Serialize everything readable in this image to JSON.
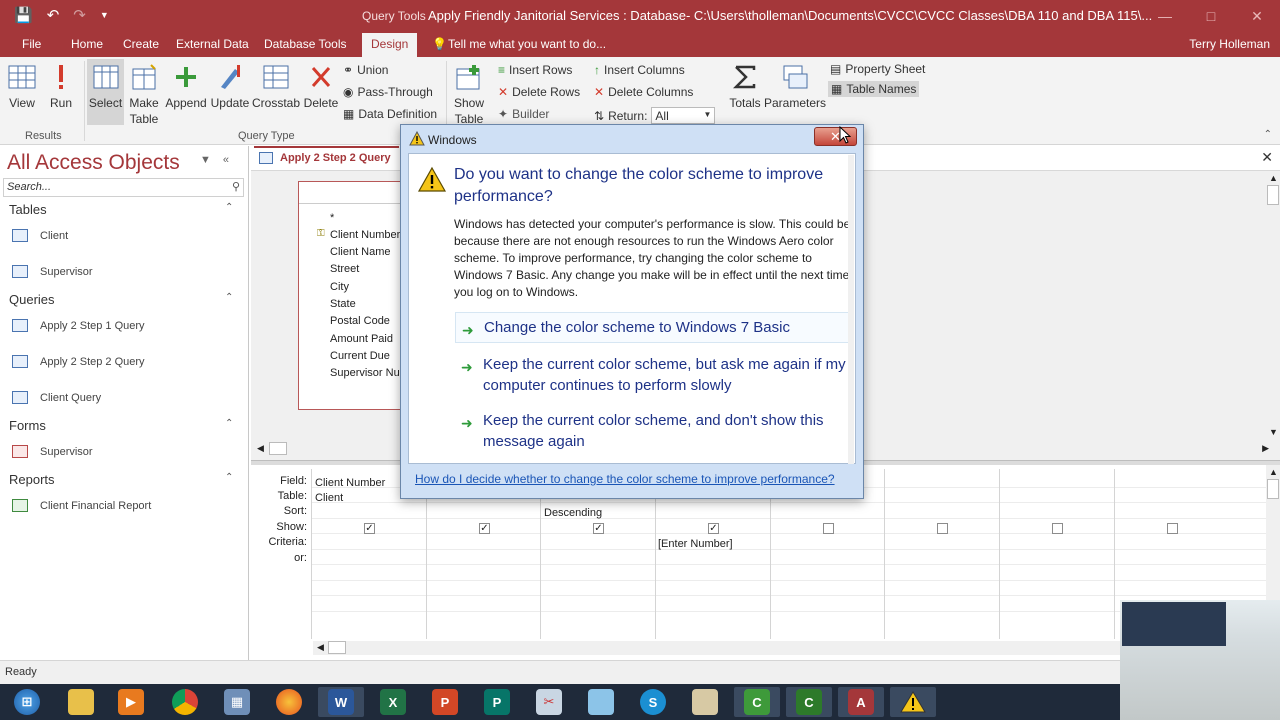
{
  "titlebar": {
    "context_tab": "Query Tools",
    "title": "Apply Friendly Janitorial Services : Database- C:\\Users\\tholleman\\Documents\\CVCC\\CVCC Classes\\DBA 110 and DBA 115\\..."
  },
  "tabs": {
    "file": "File",
    "home": "Home",
    "create": "Create",
    "external_data": "External Data",
    "database_tools": "Database Tools",
    "design": "Design",
    "tell_me": "Tell me what you want to do...",
    "user": "Terry Holleman"
  },
  "ribbon": {
    "view": "View",
    "run": "Run",
    "select": "Select",
    "make_table_1": "Make",
    "make_table_2": "Table",
    "append": "Append",
    "update": "Update",
    "crosstab": "Crosstab",
    "delete": "Delete",
    "union": "Union",
    "pass_through": "Pass-Through",
    "data_definition": "Data Definition",
    "show_table_1": "Show",
    "show_table_2": "Table",
    "insert_rows": "Insert Rows",
    "delete_rows": "Delete Rows",
    "builder": "Builder",
    "insert_columns": "Insert Columns",
    "delete_columns": "Delete Columns",
    "return_label": "Return:",
    "return_value": "All",
    "totals": "Totals",
    "parameters": "Parameters",
    "property_sheet": "Property Sheet",
    "table_names": "Table Names",
    "group_results": "Results",
    "group_query_type": "Query Type"
  },
  "nav": {
    "header": "All Access Objects",
    "search_placeholder": "Search...",
    "tables_label": "Tables",
    "tables": [
      "Client",
      "Supervisor"
    ],
    "queries_label": "Queries",
    "queries": [
      "Apply 2 Step 1 Query",
      "Apply 2 Step 2 Query",
      "Client Query"
    ],
    "forms_label": "Forms",
    "forms": [
      "Supervisor"
    ],
    "reports_label": "Reports",
    "reports": [
      "Client Financial Report"
    ]
  },
  "document": {
    "tab_label": "Apply 2 Step 2 Query",
    "table_box": {
      "star": "*",
      "fields": [
        "Client Number",
        "Client Name",
        "Street",
        "City",
        "State",
        "Postal Code",
        "Amount Paid",
        "Current Due",
        "Supervisor Nur"
      ]
    },
    "grid": {
      "row_labels": [
        "Field:",
        "Table:",
        "Sort:",
        "Show:",
        "Criteria:",
        "or:"
      ],
      "field_1": "Client Number",
      "table_1": "Client",
      "sort_3": "Descending",
      "criteria_4": "[Enter Number]",
      "show_checked": [
        "✓",
        "✓",
        "✓",
        "✓"
      ]
    }
  },
  "status": {
    "text": "Ready"
  },
  "dialog": {
    "title": "Windows",
    "close_glyph": "✕",
    "heading": "Do you want to change the color scheme to improve performance?",
    "body": "Windows has detected your computer's performance is slow. This could be because there are not enough resources to run the Windows Aero color scheme. To improve performance, try changing the color scheme to Windows 7 Basic. Any change you make will be in effect until the next time you log on to Windows.",
    "option_1": "Change the color scheme to Windows 7 Basic",
    "option_2": "Keep the current color scheme, but ask me again if my computer continues to perform slowly",
    "option_3": "Keep the current color scheme, and don't show this message again",
    "help_link": "How do I decide whether to change the color scheme to improve performance?"
  },
  "taskbar": {
    "apps": [
      "windows-start",
      "file-explorer",
      "media-player",
      "chrome",
      "calculator",
      "firefox",
      "word",
      "excel",
      "powerpoint",
      "publisher",
      "snipping-tool",
      "notepad",
      "skype",
      "paint",
      "camtasia",
      "camtasia-recorder",
      "access",
      "warning"
    ]
  },
  "colors": {
    "access_red": "#a4373a",
    "dialog_blue": "#1e3287",
    "link_blue": "#1a55b6",
    "arrow_green": "#2e9b3a"
  }
}
